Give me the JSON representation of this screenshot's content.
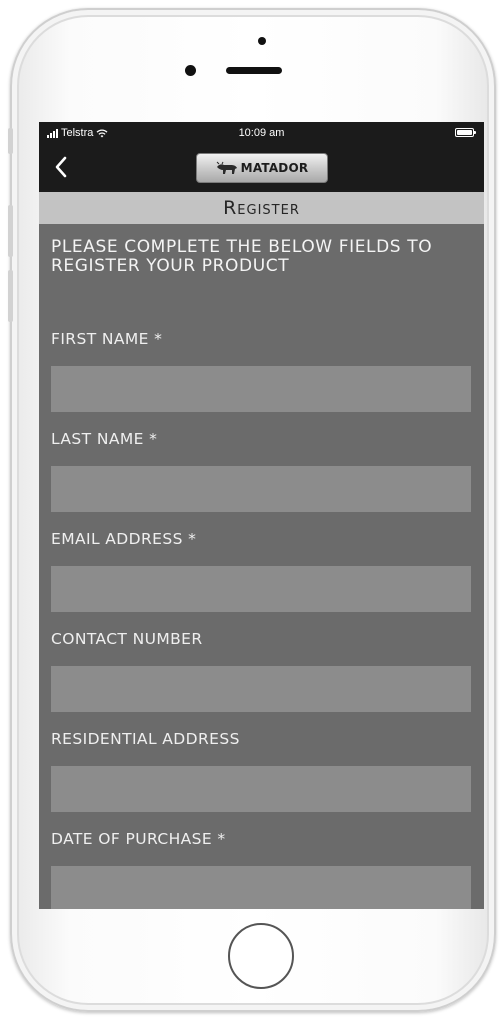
{
  "status_bar": {
    "carrier": "Telstra",
    "time": "10:09 am",
    "signal_icon": "cellular-signal-icon",
    "wifi_icon": "wifi-icon",
    "battery_icon": "battery-icon"
  },
  "nav": {
    "back_icon": "chevron-left-icon",
    "brand": "MATADOR"
  },
  "page": {
    "title": "Register",
    "intro": "PLEASE COMPLETE THE BELOW FIELDS TO REGISTER YOUR PRODUCT"
  },
  "form": {
    "fields": [
      {
        "label": "FIRST NAME *",
        "value": ""
      },
      {
        "label": "LAST NAME *",
        "value": ""
      },
      {
        "label": "EMAIL ADDRESS *",
        "value": ""
      },
      {
        "label": "CONTACT NUMBER",
        "value": ""
      },
      {
        "label": "RESIDENTIAL ADDRESS",
        "value": ""
      },
      {
        "label": "DATE OF PURCHASE *",
        "value": ""
      }
    ]
  },
  "colors": {
    "screen_bg": "#6b6b6b",
    "nav_bg": "#1b1b1b",
    "title_bar_bg": "#c3c3c3",
    "input_bg": "#8c8c8c"
  }
}
